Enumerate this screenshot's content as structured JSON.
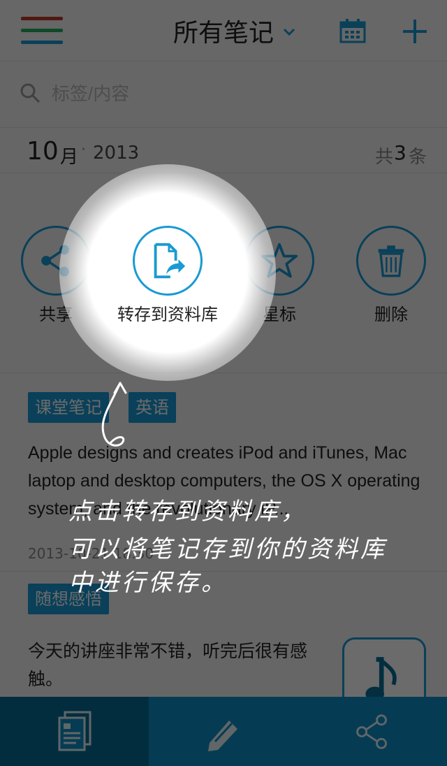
{
  "header": {
    "title": "所有笔记",
    "menu_stripe_colors": [
      "#c0392b",
      "#27ae60",
      "#1a9ad3"
    ],
    "accent": "#1a9ad3"
  },
  "search": {
    "placeholder": "标签/内容"
  },
  "month_section": {
    "month": "10",
    "month_unit": "月",
    "separator": "·",
    "year": "2013",
    "count_prefix": "共",
    "count": "3",
    "count_suffix": "条"
  },
  "actions": [
    {
      "label": "共享",
      "icon": "share-icon"
    },
    {
      "label": "转存到资料库",
      "icon": "save-to-library-icon"
    },
    {
      "label": "星标",
      "icon": "star-icon"
    },
    {
      "label": "删除",
      "icon": "trash-icon"
    }
  ],
  "notes": [
    {
      "tags": [
        "课堂笔记",
        "英语"
      ],
      "body": "Apple designs and creates iPod and iTunes, Mac laptop and desktop computers, the OS X operating system, and the revolutionary iP...",
      "date": "2013-10-21 18:30"
    },
    {
      "tags": [
        "随想感悟"
      ],
      "body": "今天的讲座非常不错，听完后很有感触。",
      "thumbnail_icon": "music-note-icon"
    }
  ],
  "bottom_tabs": [
    {
      "icon": "notes-icon",
      "active": true
    },
    {
      "icon": "edit-icon",
      "active": false
    },
    {
      "icon": "share-icon",
      "active": false
    }
  ],
  "annotation": {
    "lines": [
      "点击转存到资料库，",
      "可以将笔记存到你的资料库",
      "中进行保存。"
    ]
  }
}
